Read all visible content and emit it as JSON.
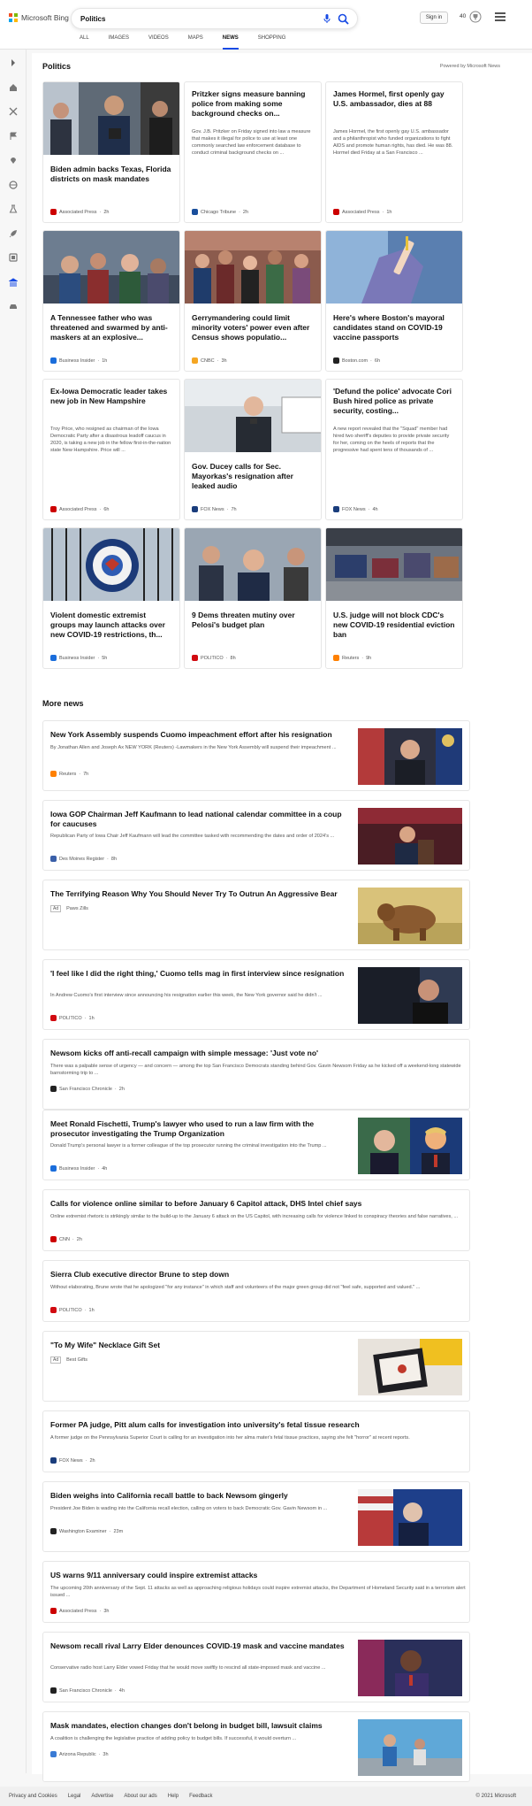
{
  "brand": {
    "name": "Microsoft Bing",
    "colors": [
      "#f25022",
      "#7fba00",
      "#00a4ef",
      "#ffb900"
    ]
  },
  "search": {
    "value": "Politics",
    "placeholder": "Search"
  },
  "header": {
    "signin_label": "Sign in",
    "points": "40"
  },
  "tabs": [
    {
      "label": "ALL"
    },
    {
      "label": "IMAGES"
    },
    {
      "label": "VIDEOS"
    },
    {
      "label": "MAPS"
    },
    {
      "label": "NEWS"
    },
    {
      "label": "SHOPPING"
    }
  ],
  "active_tab": "NEWS",
  "rail_icons": [
    "chevron-right-icon",
    "home-icon",
    "crossed-arrows-icon",
    "flag-icon",
    "map-pin-icon",
    "globe-icon",
    "science-icon",
    "rocket-icon",
    "film-icon",
    "bank-icon",
    "car-icon"
  ],
  "politics": {
    "title": "Politics",
    "powered_by": "Powered by Microsoft News",
    "cards": [
      {
        "title": "Biden admin backs Texas, Florida districts on mask mandates",
        "snippet": "",
        "source": "Associated Press",
        "age": "2h",
        "has_image": true,
        "icon_color": "#cc0000"
      },
      {
        "title": "Pritzker signs measure banning police from making some background checks on...",
        "snippet": "Gov. J.B. Pritzker on Friday signed into law a measure that makes it illegal for police to use at least one commonly searched law enforcement database to conduct criminal background checks on ...",
        "source": "Chicago Tribune",
        "age": "2h",
        "has_image": false,
        "icon_color": "#1a4f9c"
      },
      {
        "title": "James Hormel, first openly gay U.S. ambassador, dies at 88",
        "snippet": "James Hormel, the first openly gay U.S. ambassador and a philanthropist who funded organizations to fight AIDS and promote human rights, has died. He was 88. Hormel died Friday at a San Francisco ...",
        "source": "Associated Press",
        "age": "1h",
        "has_image": false,
        "icon_color": "#cc0000"
      },
      {
        "title": "A Tennessee father who was threatened and swarmed by anti-maskers at an explosive...",
        "snippet": "",
        "source": "Business Insider",
        "age": "1h",
        "has_image": true,
        "icon_color": "#1a6ddb"
      },
      {
        "title": "Gerrymandering could limit minority voters' power even after Census shows populatio...",
        "snippet": "",
        "source": "CNBC",
        "age": "3h",
        "has_image": true,
        "icon_color": "#f5a623"
      },
      {
        "title": "Here's where Boston's mayoral candidates stand on COVID-19 vaccine passports",
        "snippet": "",
        "source": "Boston.com",
        "age": "6h",
        "has_image": true,
        "icon_color": "#222222"
      },
      {
        "title": "Ex-Iowa Democratic leader takes new job in New Hampshire",
        "snippet": "Troy Price, who resigned as chairman of the Iowa Democratic Party after a disastrous leadoff caucus in 2020, is taking a new job in the fellow first-in-the-nation state New Hampshire. Price will ...",
        "source": "Associated Press",
        "age": "6h",
        "has_image": false,
        "icon_color": "#cc0000"
      },
      {
        "title": "Gov. Ducey calls for Sec. Mayorkas's resignation after leaked audio",
        "snippet": "",
        "source": "FOX News",
        "age": "7h",
        "has_image": true,
        "icon_color": "#1a3d7c"
      },
      {
        "title": "'Defund the police' advocate Cori Bush hired police as private security, costing...",
        "snippet": "A new report revealed that the \"Squad\" member had hired two sheriff's deputies to provide private security for her, coming on the heels of reports that the progressive had spent tens of thousands of ...",
        "source": "FOX News",
        "age": "4h",
        "has_image": false,
        "icon_color": "#1a3d7c"
      },
      {
        "title": "Violent domestic extremist groups may launch attacks over new COVID-19 restrictions, th...",
        "snippet": "",
        "source": "Business Insider",
        "age": "5h",
        "has_image": true,
        "icon_color": "#1a6ddb"
      },
      {
        "title": "9 Dems threaten mutiny over Pelosi's budget plan",
        "snippet": "",
        "source": "POLITICO",
        "age": "8h",
        "has_image": true,
        "icon_color": "#d10a10"
      },
      {
        "title": "U.S. judge will not block CDC's new COVID-19 residential eviction ban",
        "snippet": "",
        "source": "Reuters",
        "age": "9h",
        "has_image": true,
        "icon_color": "#ff8000"
      }
    ]
  },
  "more_news": {
    "title": "More news",
    "items": [
      {
        "title": "New York Assembly suspends Cuomo impeachment effort after his resignation",
        "snippet": "By Jonathan Allen and Joseph Ax NEW YORK (Reuters) -Lawmakers in the New York Assembly will suspend their impeachment ...",
        "source": "Reuters",
        "age": "7h",
        "ad": false,
        "has_image": true,
        "icon_color": "#ff8000"
      },
      {
        "title": "Iowa GOP Chairman Jeff Kaufmann to lead national calendar committee in a coup for caucuses",
        "snippet": "Republican Party of Iowa Chair Jeff Kaufmann will lead the committee tasked with recommending the dates and order of 2024's ...",
        "source": "Des Moines Register",
        "age": "8h",
        "ad": false,
        "has_image": true,
        "icon_color": "#3a5fa8"
      },
      {
        "title": "The Terrifying Reason Why You Should Never Try To Outrun An Aggressive Bear",
        "snippet": "",
        "source": "Paws Zills",
        "age": "",
        "ad": true,
        "ad_label": "Ad",
        "has_image": true,
        "icon_color": "#999999"
      },
      {
        "title": "'I feel like I did the right thing,' Cuomo tells mag in first interview since resignation",
        "snippet": "In Andrew Cuomo's first interview since announcing his resignation earlier this week, the New York governor said he didn't ...",
        "source": "POLITICO",
        "age": "1h",
        "ad": false,
        "has_image": true,
        "icon_color": "#d10a10"
      },
      {
        "title": "Newsom kicks off anti-recall campaign with simple message: 'Just vote no'",
        "snippet": "There was a palpable sense of urgency — and concern — among the top San Francisco Democrats standing behind Gov. Gavin Newsom Friday as he kicked off a weekend-long statewide barnstorming trip to ...",
        "source": "San Francisco Chronicle",
        "age": "2h",
        "ad": false,
        "has_image": false,
        "icon_color": "#222222"
      },
      {
        "title": "Meet Ronald Fischetti, Trump's lawyer who used to run a law firm with the prosecutor investigating the Trump Organization",
        "snippet": "Donald Trump's personal lawyer is a former colleague of the top prosecutor running the criminal investigation into the Trump ...",
        "source": "Business Insider",
        "age": "4h",
        "ad": false,
        "has_image": true,
        "icon_color": "#1a6ddb"
      },
      {
        "title": "Calls for violence online similar to before January 6 Capitol attack, DHS Intel chief says",
        "snippet": "Online extremist rhetoric is strikingly similar to the build-up to the January 6 attack on the US Capitol, with increasing calls for violence linked to conspiracy theories and false narratives, ...",
        "source": "CNN",
        "age": "2h",
        "ad": false,
        "has_image": false,
        "icon_color": "#cc0000"
      },
      {
        "title": "Sierra Club executive director Brune to step down",
        "snippet": "Without elaborating, Brune wrote that he apologized \"for any instance\" in which staff and volunteers of the major green group did not \"feel safe, supported and valued.\" ...",
        "source": "POLITICO",
        "age": "1h",
        "ad": false,
        "has_image": false,
        "icon_color": "#d10a10"
      },
      {
        "title": "\"To My Wife\" Necklace Gift Set",
        "snippet": "",
        "source": "Best Gifts",
        "age": "",
        "ad": true,
        "ad_label": "Ad",
        "has_image": true,
        "icon_color": "#999999"
      },
      {
        "title": "Former PA judge, Pitt alum calls for investigation into university's fetal tissue research",
        "snippet": "A former judge on the Pennsylvania Superior Court is calling for an investigation into her alma mater's fetal tissue practices, saying she felt \"horror\" at recent reports.",
        "source": "FOX News",
        "age": "2h",
        "ad": false,
        "has_image": false,
        "icon_color": "#1a3d7c"
      },
      {
        "title": "Biden weighs into California recall battle to back Newsom gingerly",
        "snippet": "President Joe Biden is wading into the California recall election, calling on voters to back Democratic Gov. Gavin Newsom in ...",
        "source": "Washington Examiner",
        "age": "23m",
        "ad": false,
        "has_image": true,
        "icon_color": "#222222"
      },
      {
        "title": "US warns 9/11 anniversary could inspire extremist attacks",
        "snippet": "The upcoming 20th anniversary of the Sept. 11 attacks as well as approaching religious holidays could inspire extremist attacks, the Department of Homeland Security said in a terrorism alert issued ...",
        "source": "Associated Press",
        "age": "3h",
        "ad": false,
        "has_image": false,
        "icon_color": "#cc0000"
      },
      {
        "title": "Newsom recall rival Larry Elder denounces COVID-19 mask and vaccine mandates",
        "snippet": "Conservative radio host Larry Elder vowed Friday that he would move swiftly to rescind all state-imposed mask and vaccine ...",
        "source": "San Francisco Chronicle",
        "age": "4h",
        "ad": false,
        "has_image": true,
        "icon_color": "#222222"
      },
      {
        "title": "Mask mandates, election changes don't belong in budget bill, lawsuit claims",
        "snippet": "A coalition is challenging the legislative practice of adding policy to budget bills. If successful, it would overturn ...",
        "source": "Arizona Republic",
        "age": "3h",
        "ad": false,
        "has_image": true,
        "icon_color": "#3a7bd5"
      }
    ]
  },
  "footer": {
    "links": [
      "Privacy and Cookies",
      "Legal",
      "Advertise",
      "About our ads",
      "Help",
      "Feedback"
    ],
    "copyright": "© 2021 Microsoft"
  }
}
